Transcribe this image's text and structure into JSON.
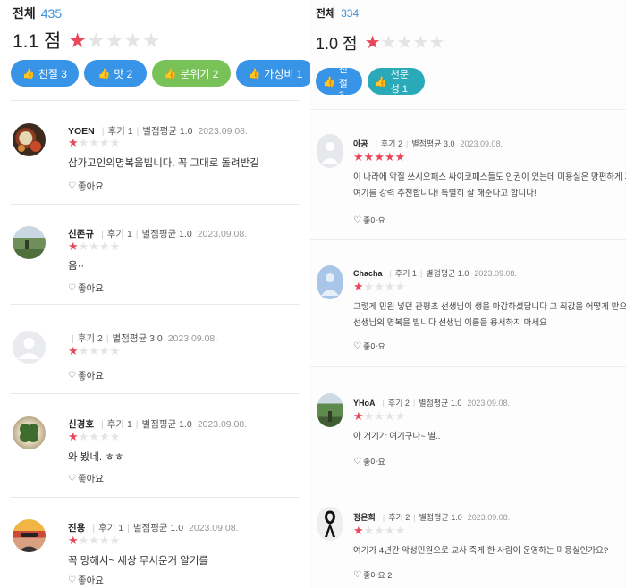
{
  "left": {
    "total_label": "전체",
    "total_count": "435",
    "score": "1.1 점",
    "score_stars": 1,
    "chips": [
      {
        "label": "친절 3",
        "color": "#3794e6"
      },
      {
        "label": "맛 2",
        "color": "#3794e6"
      },
      {
        "label": "분위기 2",
        "color": "#79c257"
      },
      {
        "label": "가성비 1",
        "color": "#3794e6"
      }
    ],
    "reviews": [
      {
        "name": "YOEN",
        "reviews": "후기 1",
        "avg": "별점평균 1.0",
        "date": "2023.09.08.",
        "stars": 1,
        "text": [
          "삼가고인의명복을빕니다. 꼭 그대로 돌려받길"
        ],
        "like": "좋아요",
        "avatar": "tea-photo"
      },
      {
        "name": "신존규",
        "reviews": "후기 1",
        "avg": "별점평균 1.0",
        "date": "2023.09.08.",
        "stars": 1,
        "text": [
          "음··"
        ],
        "like": "좋아요",
        "avatar": "landscape-photo"
      },
      {
        "name": "",
        "reviews": "후기 2",
        "avg": "별점평균 3.0",
        "date": "2023.09.08.",
        "stars": 1,
        "text": [],
        "like": "좋아요",
        "avatar": "default-avatar"
      },
      {
        "name": "신경호",
        "reviews": "후기 1",
        "avg": "별점평균 1.0",
        "date": "2023.09.08.",
        "stars": 1,
        "text": [
          "와 봤네. ㅎㅎ"
        ],
        "like": "좋아요",
        "avatar": "clover-photo"
      },
      {
        "name": "진용",
        "reviews": "후기 1",
        "avg": "별점평균 1.0",
        "date": "2023.09.08.",
        "stars": 1,
        "text": [
          "꼭 망해서~ 세상 무서운거 알기를"
        ],
        "like": "좋아요",
        "avatar": "person-photo"
      }
    ]
  },
  "right": {
    "total_label": "전체",
    "total_count": "334",
    "score": "1.0 점",
    "score_stars": 1,
    "chips": [
      {
        "label": "친절 3",
        "color": "#3794e6"
      },
      {
        "label": "전문성 1",
        "color": "#2aa9b8"
      }
    ],
    "reviews": [
      {
        "name": "아공",
        "reviews": "후기 2",
        "avg": "별점평균 3.0",
        "date": "2023.09.08.",
        "stars": 5,
        "text": [
          "이 나라에 악질 쓰시오패스 싸이코패스들도 인권이 있는데 미용실은 망편하게 가야죠.",
          "여기를 강력 추천합니다! 특별히 잘 해준다고 합디다!"
        ],
        "like": "좋아요",
        "avatar": "default-avatar"
      },
      {
        "name": "Chacha",
        "reviews": "후기 1",
        "avg": "별점평균 1.0",
        "date": "2023.09.08.",
        "stars": 1,
        "text": [
          "그렇게 민원 넣던 관평초 선생님이 생을 마감하셨답니다 그 죄값을 어떻게 받으시려고..",
          "선생님의 명복을 빕니다 선생님 이름을 용서하지 마세요"
        ],
        "like": "좋아요",
        "avatar": "blue-avatar"
      },
      {
        "name": "YHoA",
        "reviews": "후기 2",
        "avg": "별점평균 1.0",
        "date": "2023.09.08.",
        "stars": 1,
        "text": [
          "아 거기가 여기구나~ 별.."
        ],
        "like": "좋아요",
        "avatar": "tree-photo"
      },
      {
        "name": "정은희",
        "reviews": "후기 2",
        "avg": "별점평균 1.0",
        "date": "2023.09.08.",
        "stars": 1,
        "text": [
          "여기가 4년간 악성민원으로 교사 죽게 한 사람이 운영하는 미용실인가요?"
        ],
        "like": "좋아요 2",
        "avatar": "ribbon-avatar"
      }
    ]
  }
}
